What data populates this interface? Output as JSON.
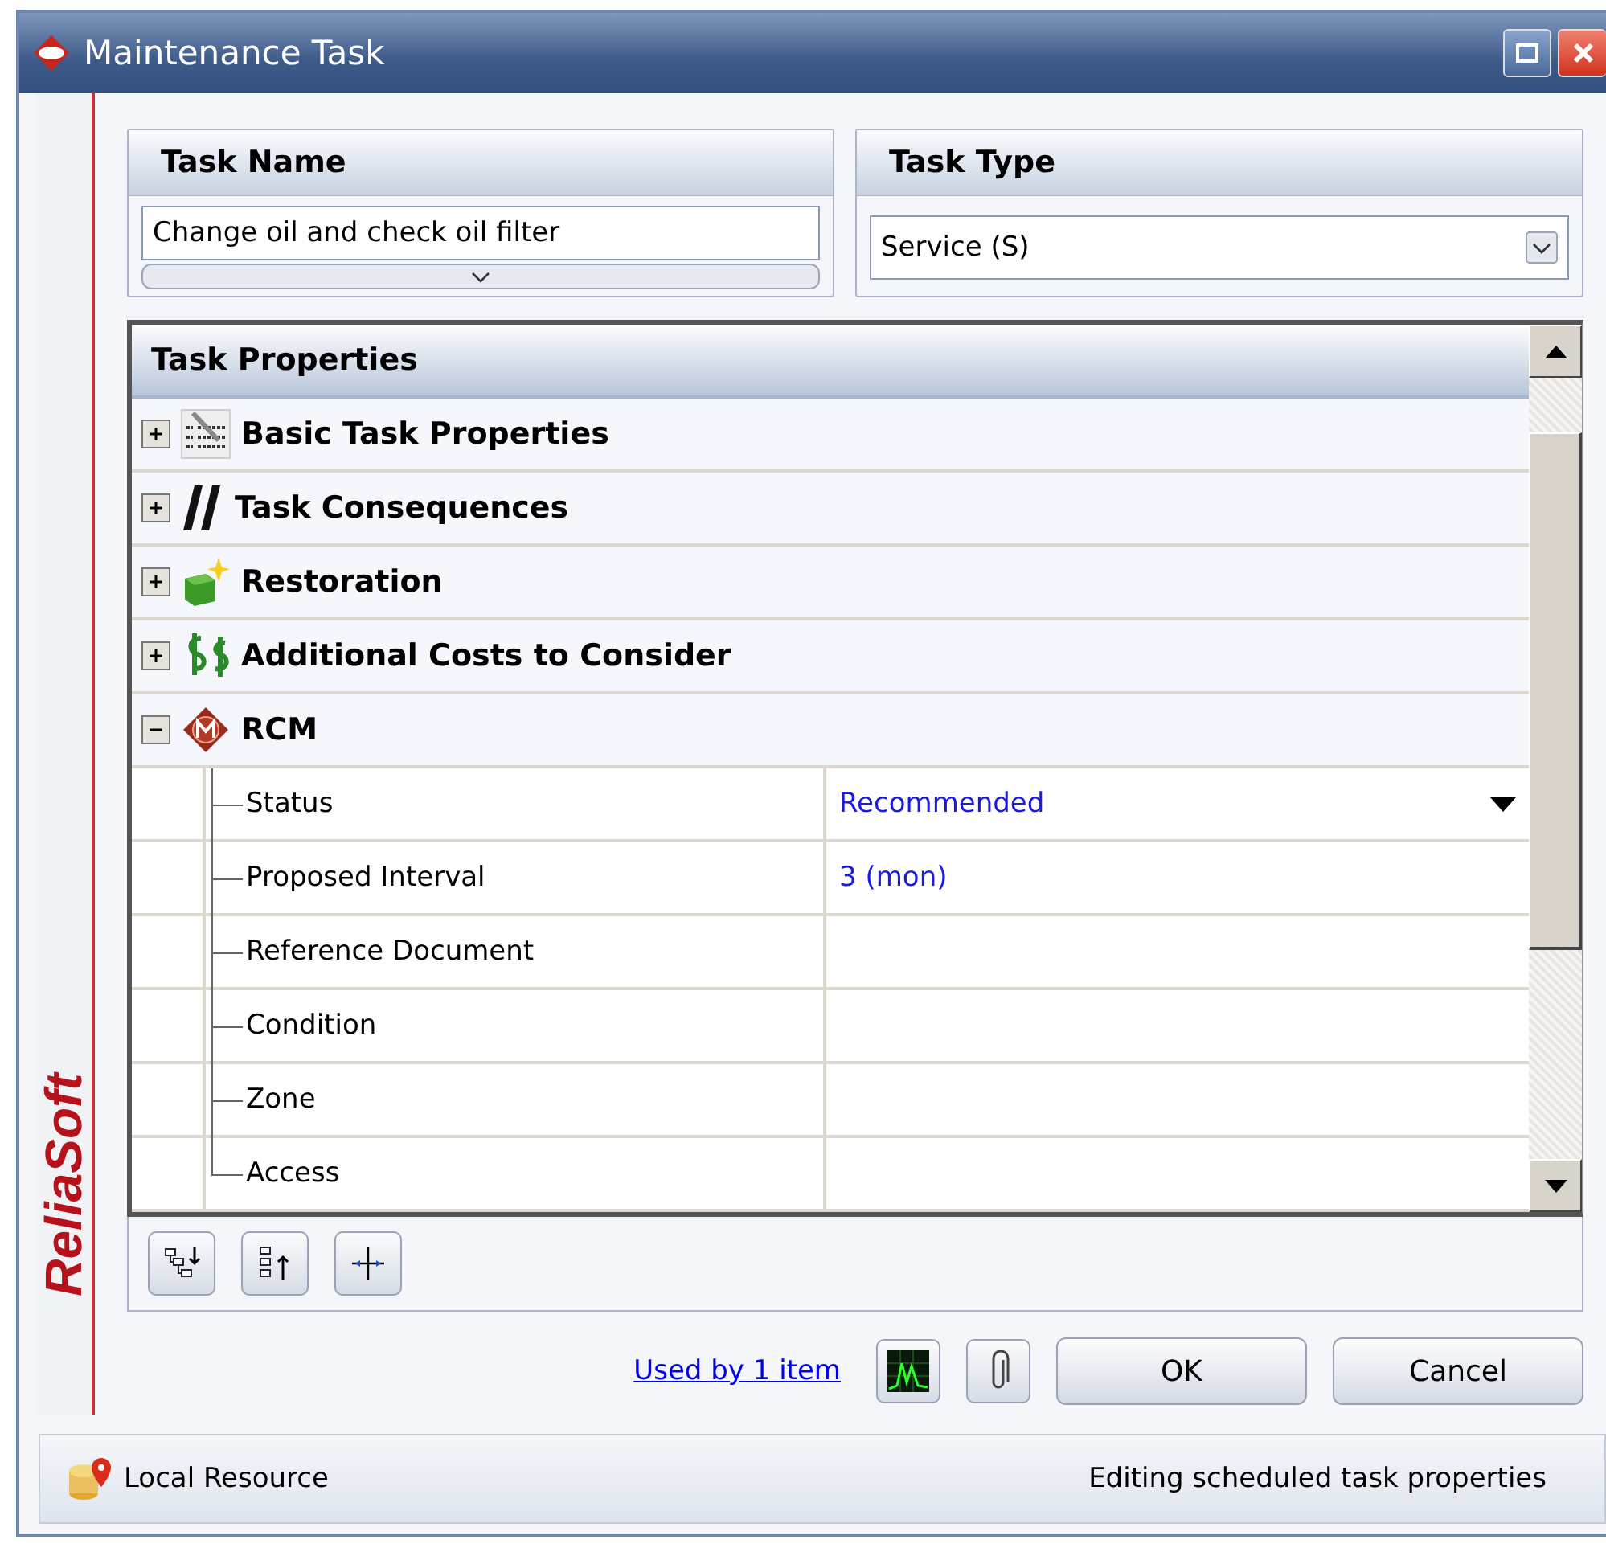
{
  "window": {
    "title": "Maintenance Task"
  },
  "brand": "ReliaSoft",
  "task_name": {
    "heading": "Task Name",
    "value": "Change oil and check oil filter"
  },
  "task_type": {
    "heading": "Task Type",
    "value": "Service (S)"
  },
  "properties": {
    "heading": "Task Properties",
    "groups": [
      {
        "label": "Basic Task Properties",
        "expanded": false
      },
      {
        "label": "Task Consequences",
        "expanded": false
      },
      {
        "label": "Restoration",
        "expanded": false
      },
      {
        "label": "Additional Costs to Consider",
        "expanded": false
      },
      {
        "label": "RCM",
        "expanded": true,
        "children": [
          {
            "name": "Status",
            "value": "Recommended",
            "kind": "dropdown"
          },
          {
            "name": "Proposed Interval",
            "value": "3 (mon)",
            "kind": "text"
          },
          {
            "name": "Reference Document",
            "kind": "text"
          },
          {
            "name": "Condition",
            "kind": "text"
          },
          {
            "name": "Zone",
            "kind": "text"
          },
          {
            "name": "Access",
            "kind": "text"
          }
        ]
      }
    ]
  },
  "link": "Used by 1 item",
  "buttons": [
    "OK",
    "Cancel"
  ],
  "status_bar": {
    "left": "Local Resource",
    "right": "Editing scheduled task properties"
  }
}
